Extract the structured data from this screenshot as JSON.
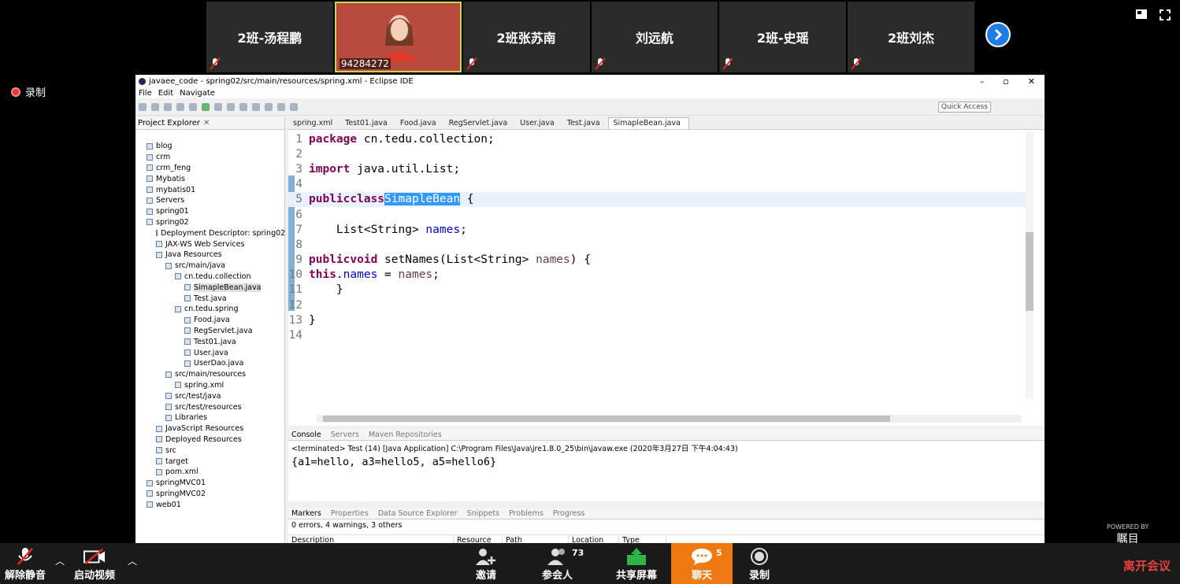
{
  "participants": [
    {
      "name": "2班-汤程鹏"
    },
    {
      "name": "94284272",
      "video": true
    },
    {
      "name": "2班张苏南"
    },
    {
      "name": "刘远航"
    },
    {
      "name": "2班-史瑶"
    },
    {
      "name": "2班刘杰"
    }
  ],
  "recording_label": "录制",
  "eclipse": {
    "title": "javaee_code - spring02/src/main/resources/spring.xml - Eclipse IDE",
    "menu": [
      "File",
      "Edit",
      "Navigate"
    ],
    "quick_access": "Quick Access",
    "explorer_title": "Project Explorer",
    "tree": [
      {
        "label": "blog",
        "indent": 0
      },
      {
        "label": "crm",
        "indent": 0
      },
      {
        "label": "crm_feng",
        "indent": 0
      },
      {
        "label": "Mybatis",
        "indent": 0
      },
      {
        "label": "mybatis01",
        "indent": 0
      },
      {
        "label": "Servers",
        "indent": 0
      },
      {
        "label": "spring01",
        "indent": 0
      },
      {
        "label": "spring02",
        "indent": 0
      },
      {
        "label": "Deployment Descriptor: spring02",
        "indent": 1
      },
      {
        "label": "JAX-WS Web Services",
        "indent": 1
      },
      {
        "label": "Java Resources",
        "indent": 1
      },
      {
        "label": "src/main/java",
        "indent": 2
      },
      {
        "label": "cn.tedu.collection",
        "indent": 3
      },
      {
        "label": "SimapleBean.java",
        "indent": 4,
        "selected": true
      },
      {
        "label": "Test.java",
        "indent": 4
      },
      {
        "label": "cn.tedu.spring",
        "indent": 3
      },
      {
        "label": "Food.java",
        "indent": 4
      },
      {
        "label": "RegServlet.java",
        "indent": 4
      },
      {
        "label": "Test01.java",
        "indent": 4
      },
      {
        "label": "User.java",
        "indent": 4
      },
      {
        "label": "UserDao.java",
        "indent": 4
      },
      {
        "label": "src/main/resources",
        "indent": 2
      },
      {
        "label": "spring.xml",
        "indent": 3
      },
      {
        "label": "src/test/java",
        "indent": 2
      },
      {
        "label": "src/test/resources",
        "indent": 2
      },
      {
        "label": "Libraries",
        "indent": 2
      },
      {
        "label": "JavaScript Resources",
        "indent": 1
      },
      {
        "label": "Deployed Resources",
        "indent": 1
      },
      {
        "label": "src",
        "indent": 1
      },
      {
        "label": "target",
        "indent": 1
      },
      {
        "label": "pom.xml",
        "indent": 1
      },
      {
        "label": "springMVC01",
        "indent": 0
      },
      {
        "label": "springMVC02",
        "indent": 0
      },
      {
        "label": "web01",
        "indent": 0
      }
    ],
    "editor_tabs": [
      "spring.xml",
      "Test01.java",
      "Food.java",
      "RegServlet.java",
      "User.java",
      "Test.java",
      "SimapleBean.java"
    ],
    "active_tab": "SimapleBean.java",
    "line_numbers": [
      "1",
      "2",
      "3",
      "4",
      "5",
      "6",
      "7",
      "8",
      "9",
      "10",
      "11",
      "12",
      "13",
      "14"
    ],
    "code": {
      "l1_kw": "package",
      "l1_rest": " cn.tedu.collection;",
      "l3_kw": "import",
      "l3_rest": " java.util.List;",
      "l5_kw1": "public",
      "l5_kw2": "class",
      "l5_name": "SimapleBean",
      "l5_rest": " {",
      "l7_type": "    List<String> ",
      "l7_field": "names",
      "l7_end": ";",
      "l9_kw1": "public",
      "l9_kw2": "void",
      "l9_rest": " setNames(List<String> ",
      "l9_param": "names",
      "l9_end": ") {",
      "l10_kw": "this",
      "l10_dot": ".",
      "l10_field": "names",
      "l10_eq": " = ",
      "l10_val": "names",
      "l10_end": ";",
      "l11": "    }",
      "l13": "}"
    },
    "console_tabs": [
      "Console",
      "Servers",
      "Maven Repositories"
    ],
    "console_info": "<terminated> Test (14) [Java Application] C:\\Program Files\\Java\\jre1.8.0_25\\bin\\javaw.exe (2020年3月27日 下午4:04:43)",
    "console_output": "{a1=hello, a3=hello5, a5=hello6}",
    "marker_tabs": [
      "Markers",
      "Properties",
      "Data Source Explorer",
      "Snippets",
      "Problems",
      "Progress"
    ],
    "marker_summary": "0 errors, 4 warnings, 3 others",
    "marker_columns": [
      "Description",
      "Resource",
      "Path",
      "Location",
      "Type"
    ]
  },
  "bottom": {
    "unmute": "解除静音",
    "start_video": "启动视频",
    "invite": "邀请",
    "participants": "参会人",
    "participants_count": "73",
    "share": "共享屏幕",
    "chat": "聊天",
    "chat_badge": "5",
    "record": "录制",
    "leave": "离开会议",
    "powered_by": "POWERED BY",
    "powered_brand": "瞩目"
  }
}
